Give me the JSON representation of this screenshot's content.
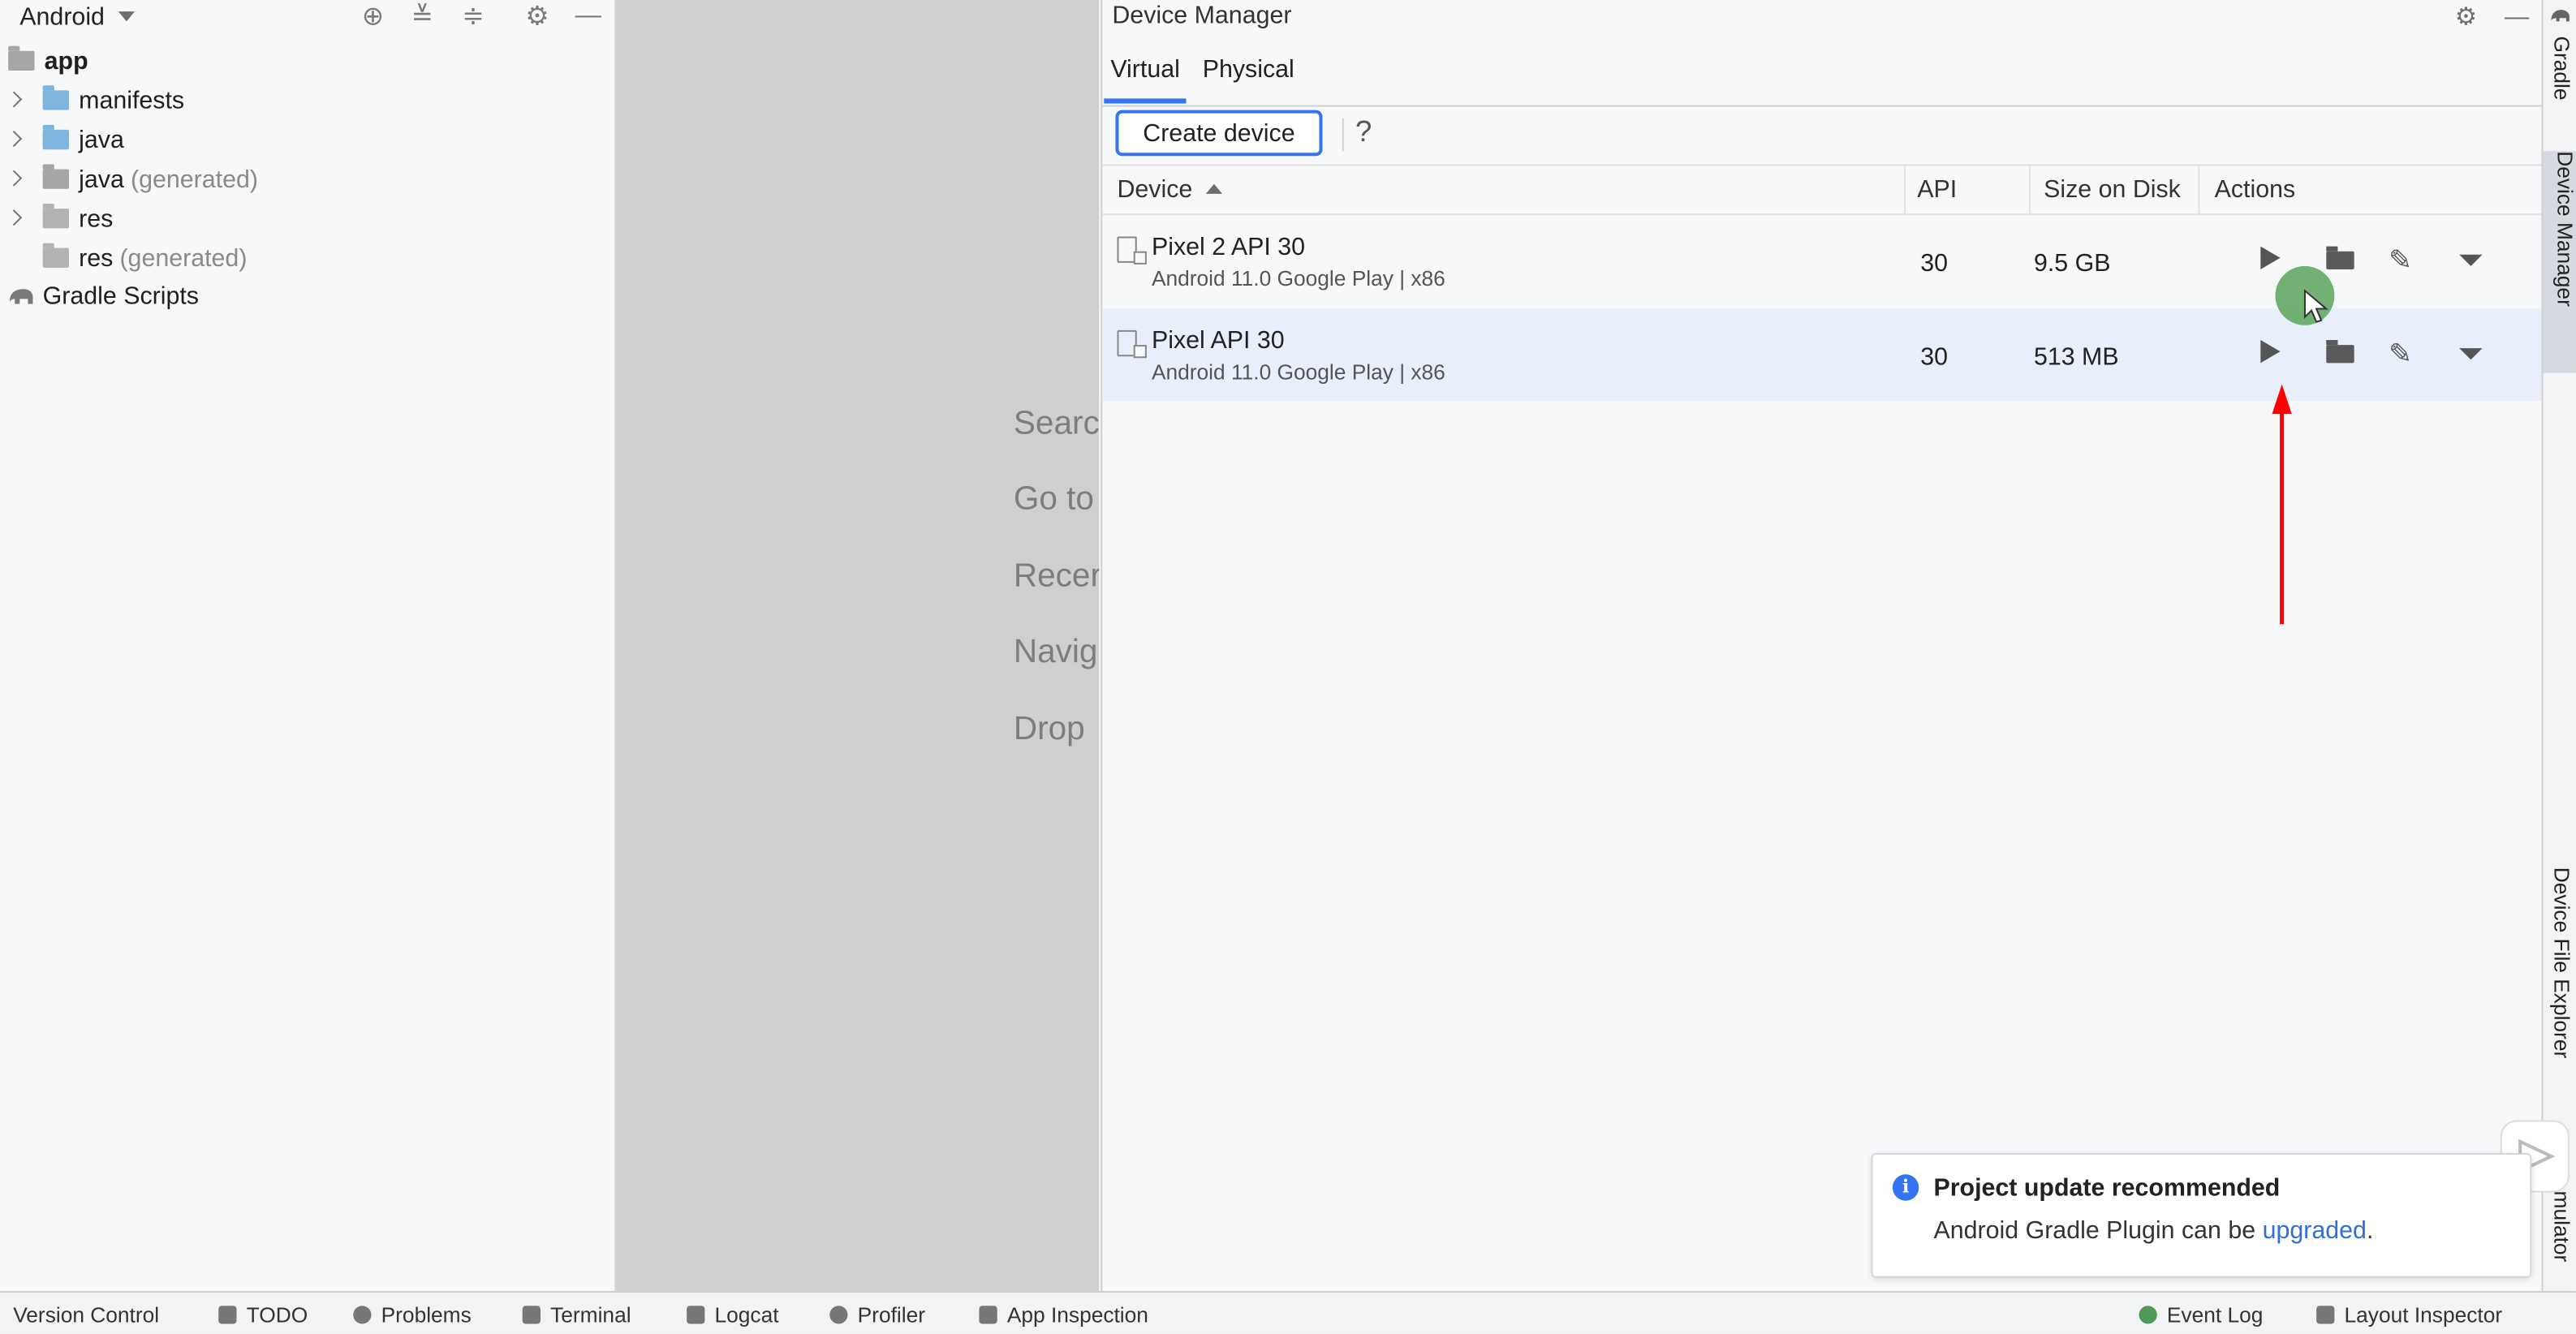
{
  "project": {
    "title": "Android",
    "tree": [
      {
        "label": "app",
        "extra": ""
      },
      {
        "label": "manifests",
        "extra": ""
      },
      {
        "label": "java",
        "extra": ""
      },
      {
        "label": "java",
        "extra": "(generated)"
      },
      {
        "label": "res",
        "extra": ""
      },
      {
        "label": "res",
        "extra": "(generated)"
      },
      {
        "label": "Gradle Scripts",
        "extra": ""
      }
    ]
  },
  "editor": {
    "hints": [
      "Searcl",
      "Go to",
      "Recer",
      "Navig",
      "Drop"
    ]
  },
  "device_manager": {
    "title": "Device Manager",
    "tabs": [
      "Virtual",
      "Physical"
    ],
    "create_label": "Create device",
    "help_label": "?",
    "columns": {
      "device": "Device",
      "api": "API",
      "size": "Size on Disk",
      "actions": "Actions"
    },
    "devices": [
      {
        "name": "Pixel 2 API 30",
        "sub": "Android 11.0 Google Play | x86",
        "api": "30",
        "size": "9.5 GB"
      },
      {
        "name": "Pixel API 30",
        "sub": "Android 11.0 Google Play | x86",
        "api": "30",
        "size": "513 MB"
      }
    ]
  },
  "right_stripe": {
    "gradle": "Gradle",
    "device_manager": "Device Manager",
    "device_file_explorer": "Device File Explorer",
    "emulator": "mulator"
  },
  "notification": {
    "title": "Project update recommended",
    "body_prefix": "Android Gradle Plugin can be ",
    "link": "upgraded",
    "body_suffix": "."
  },
  "bottom_bar": {
    "items": [
      "Version Control",
      "TODO",
      "Problems",
      "Terminal",
      "Logcat",
      "Profiler",
      "App Inspection"
    ],
    "right_items": [
      "Event Log",
      "Layout Inspector"
    ]
  },
  "colors": {
    "accent": "#3574f0",
    "selection": "#e8eefa",
    "annotation_arrow": "#ff0000",
    "cursor_highlight": "#5aa55a"
  }
}
